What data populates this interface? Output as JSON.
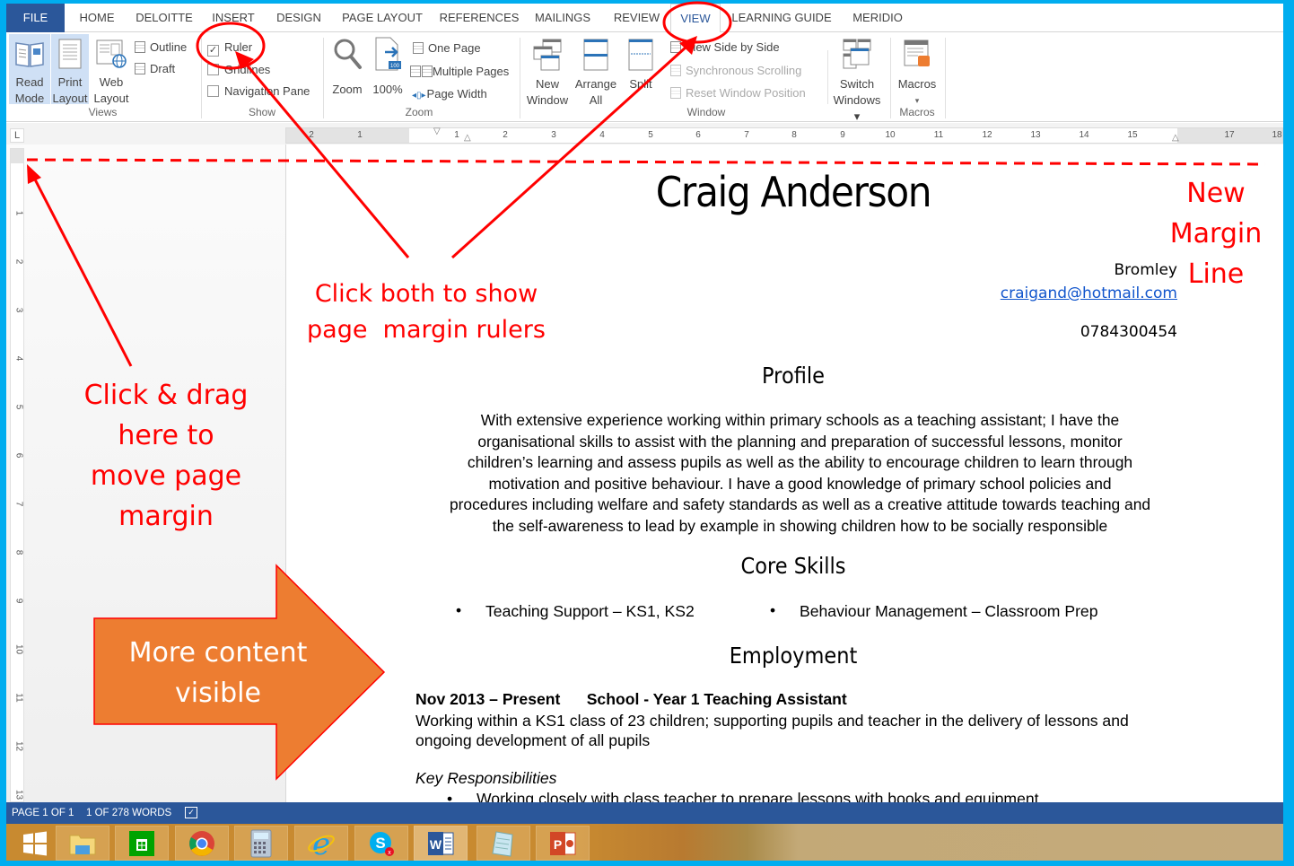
{
  "tabs": [
    {
      "label": "FILE"
    },
    {
      "label": "HOME"
    },
    {
      "label": "DELOITTE"
    },
    {
      "label": "INSERT"
    },
    {
      "label": "DESIGN"
    },
    {
      "label": "PAGE LAYOUT"
    },
    {
      "label": "REFERENCES"
    },
    {
      "label": "MAILINGS"
    },
    {
      "label": "REVIEW"
    },
    {
      "label": "VIEW",
      "active": true
    },
    {
      "label": "LEARNING GUIDE"
    },
    {
      "label": "MERIDIO"
    }
  ],
  "ribbon": {
    "views": {
      "label": "Views",
      "read_mode": "Read Mode",
      "read_mode_l1": "Read",
      "read_mode_l2": "Mode",
      "print_layout_l1": "Print",
      "print_layout_l2": "Layout",
      "web_layout_l1": "Web",
      "web_layout_l2": "Layout",
      "outline": "Outline",
      "draft": "Draft"
    },
    "show": {
      "label": "Show",
      "ruler": "Ruler",
      "ruler_checked": true,
      "gridlines": "Gridlines",
      "gridlines_checked": false,
      "navigation_pane": "Navigation Pane",
      "navigation_pane_checked": false
    },
    "zoom": {
      "label": "Zoom",
      "zoom": "Zoom",
      "hundred": "100%",
      "one_page": "One Page",
      "multiple_pages": "Multiple Pages",
      "page_width": "Page Width"
    },
    "window": {
      "label": "Window",
      "new_window_l1": "New",
      "new_window_l2": "Window",
      "arrange_all_l1": "Arrange",
      "arrange_all_l2": "All",
      "split": "Split",
      "view_side_by_side": "View Side by Side",
      "synchronous_scrolling": "Synchronous Scrolling",
      "reset_window_position": "Reset Window Position",
      "switch_windows_l1": "Switch",
      "switch_windows_l2": "Windows ▾"
    },
    "macros": {
      "label": "Macros",
      "macros": "Macros",
      "dropdown": "▾"
    }
  },
  "ruler": {
    "tab_selector": "L",
    "horizontal_labels": [
      "2",
      "1",
      "1",
      "2",
      "3",
      "4",
      "5",
      "6",
      "7",
      "8",
      "9",
      "10",
      "11",
      "12",
      "13",
      "14",
      "15",
      "17",
      "18"
    ],
    "vertical_labels": [
      "1",
      "2",
      "3",
      "4",
      "5",
      "6",
      "7",
      "8",
      "9",
      "10",
      "11",
      "12",
      "13"
    ]
  },
  "document": {
    "name": "Craig Anderson",
    "location": "Bromley",
    "email": "craigand@hotmail.com",
    "phone": "0784300454",
    "profile_heading": "Profile",
    "profile_lines": [
      "With extensive experience working within primary schools as a teaching assistant; I have the",
      "organisational skills to assist with the planning and preparation of successful lessons, monitor",
      "children’s learning and assess pupils as well as the ability to encourage children to learn through",
      "motivation and positive behaviour.  I have a good knowledge of primary school policies and",
      "procedures including welfare and safety standards as well as a creative attitude towards teaching and",
      "the self-awareness to lead by example in showing children how to be socially responsible"
    ],
    "core_skills_heading": "Core Skills",
    "skills": [
      "Teaching Support – KS1, KS2",
      "Behaviour Management – Classroom Prep"
    ],
    "employment_heading": "Employment",
    "job_title": "Nov 2013 – Present      School - Year 1 Teaching Assistant",
    "job_desc": "Working within a KS1 class of 23 children; supporting pupils and teacher in the delivery of lessons and ongoing development of all pupils",
    "key_responsibilities": "Key Responsibilities",
    "responsibilities": [
      "Working closely with class teacher to prepare lessons with books and equipment"
    ]
  },
  "statusbar": {
    "page": "PAGE 1 OF 1",
    "words": "1 OF 278 WORDS"
  },
  "taskbar": {
    "apps": [
      "start",
      "file-explorer",
      "store",
      "chrome",
      "calculator",
      "internet-explorer",
      "skype",
      "word",
      "notepad",
      "powerpoint"
    ]
  },
  "annotations": {
    "click_both": [
      "Click both to show",
      "page  margin rulers"
    ],
    "click_drag": [
      "Click & drag",
      "here to",
      "move page",
      "margin"
    ],
    "new_margin": [
      "New",
      "Margin",
      "Line"
    ],
    "more_content": [
      "More content",
      "visible"
    ],
    "color": "#ff0000",
    "arrow_fill": "#ed7d31"
  }
}
